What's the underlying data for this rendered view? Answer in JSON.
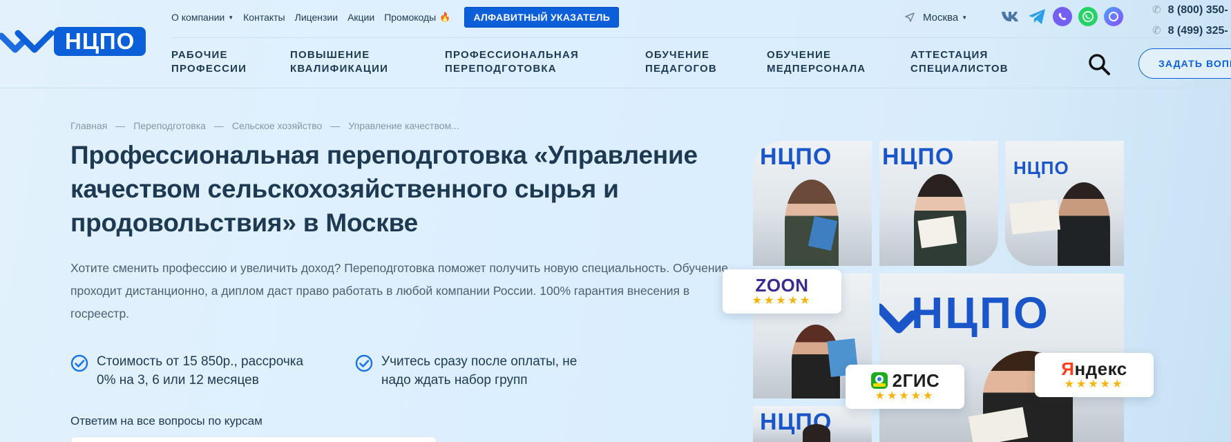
{
  "header": {
    "logo_text": "НЦПО",
    "top_links": [
      {
        "label": "О компании"
      },
      {
        "label": "Контакты"
      },
      {
        "label": "Лицензии"
      },
      {
        "label": "Акции"
      },
      {
        "label": "Промокоды"
      }
    ],
    "alpha_index_label": "АЛФАВИТНЫЙ УКАЗАТЕЛЬ",
    "city": "Москва",
    "socials": [
      "vk-icon",
      "telegram-icon",
      "viber-icon",
      "whatsapp-icon",
      "max-icon"
    ],
    "phones": [
      "8 (800) 350-",
      "8 (499) 325-"
    ],
    "nav": [
      {
        "line1": "РАБОЧИЕ",
        "line2": "ПРОФЕССИИ"
      },
      {
        "line1": "ПОВЫШЕНИЕ",
        "line2": "КВАЛИФИКАЦИИ"
      },
      {
        "line1": "ПРОФЕССИОНАЛЬНАЯ",
        "line2": "ПЕРЕПОДГОТОВКА"
      },
      {
        "line1": "ОБУЧЕНИЕ",
        "line2": "ПЕДАГОГОВ"
      },
      {
        "line1": "ОБУЧЕНИЕ",
        "line2": "МЕДПЕРСОНАЛА"
      },
      {
        "line1": "АТТЕСТАЦИЯ",
        "line2": "СПЕЦИАЛИСТОВ"
      }
    ],
    "ask_label": "ЗАДАТЬ ВОПР"
  },
  "breadcrumb": [
    "Главная",
    "Переподготовка",
    "Сельское хозяйство",
    "Управление качеством..."
  ],
  "breadcrumb_sep": "—",
  "title": "Профессиональная переподготовка «Управление качеством сельскохозяйственного сырья и продовольствия» в Москве",
  "lead": "Хотите сменить профессию и увеличить доход? Переподготовка поможет получить новую специальность. Обучение проходит дистанционно, а диплом даст право работать в любой компании России. 100% гарантия внесения в госреестр.",
  "features": [
    {
      "line1": "Стоимость от 15 850р., рассрочка",
      "line2": "0% на 3, 6 или 12 месяцев"
    },
    {
      "line1": "Учитесь сразу после оплаты, не",
      "line2": "надо ждать набор групп"
    }
  ],
  "answer_label": "Ответим на все вопросы по курсам",
  "photo_sign": "НЦПО",
  "badges": [
    {
      "name": "ZOON",
      "stars": "★★★★★",
      "color": "#3b2a8f"
    },
    {
      "name": "2ГИС",
      "stars": "★★★★★",
      "color": "#1e1e1e"
    },
    {
      "name": "Яндекс",
      "stars": "★★★★★",
      "color": "#1e1e1e"
    }
  ],
  "colors": {
    "brand": "#0b5fd8",
    "text": "#1e3a52",
    "muted": "#8596a6"
  }
}
